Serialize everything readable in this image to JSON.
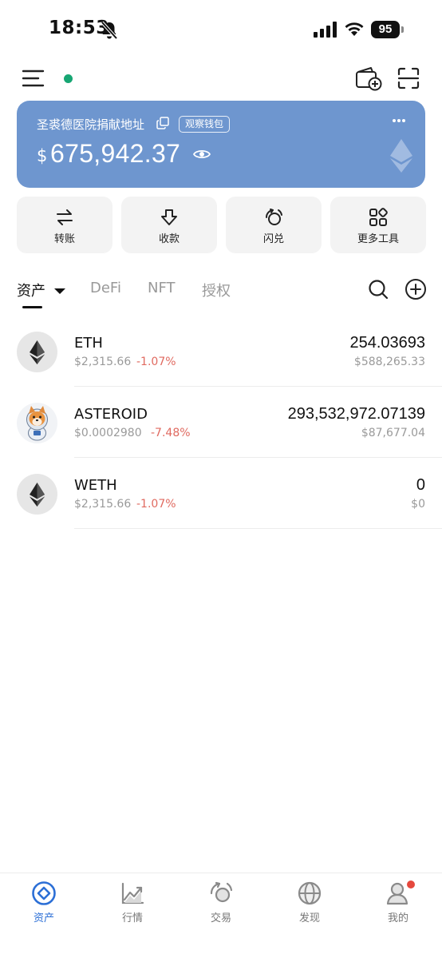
{
  "status_bar": {
    "time": "18:53",
    "battery": "95",
    "icons": [
      "bell-muted-icon",
      "signal-icon",
      "wifi-icon",
      "battery-icon"
    ]
  },
  "top_bar": {
    "icons": [
      "menu-icon",
      "wallet-add-icon",
      "scan-icon"
    ],
    "online_dot_color": "#17a673"
  },
  "wallet_card": {
    "name": "圣裘德医院捐献地址",
    "badge": "观察钱包",
    "currency_symbol": "$",
    "balance": "675,942.37",
    "background_color": "#6e96cf"
  },
  "actions": [
    {
      "label": "转账",
      "icon": "transfer-icon"
    },
    {
      "label": "收款",
      "icon": "receive-icon"
    },
    {
      "label": "闪兑",
      "icon": "swap-icon"
    },
    {
      "label": "更多工具",
      "icon": "tools-grid-icon"
    }
  ],
  "tabs": [
    {
      "label": "资产",
      "active": true
    },
    {
      "label": "DeFi",
      "active": false
    },
    {
      "label": "NFT",
      "active": false
    },
    {
      "label": "授权",
      "active": false
    }
  ],
  "tokens": [
    {
      "symbol": "ETH",
      "price": "$2,315.66",
      "change": "-1.07%",
      "amount": "254.03693",
      "value": "$588,265.33",
      "logo": "eth-logo-icon"
    },
    {
      "symbol": "ASTEROID",
      "price": "$0.0002980",
      "change": "-7.48%",
      "amount": "293,532,972.07139",
      "value": "$87,677.04",
      "logo": "shiba-astronaut-icon"
    },
    {
      "symbol": "WETH",
      "price": "$2,315.66",
      "change": "-1.07%",
      "amount": "0",
      "value": "$0",
      "logo": "eth-logo-icon"
    }
  ],
  "bottom_nav": [
    {
      "label": "资产",
      "icon": "assets-icon",
      "active": true
    },
    {
      "label": "行情",
      "icon": "market-icon",
      "active": false
    },
    {
      "label": "交易",
      "icon": "trade-icon",
      "active": false
    },
    {
      "label": "发现",
      "icon": "discover-globe-icon",
      "active": false
    },
    {
      "label": "我的",
      "icon": "profile-icon",
      "active": false,
      "badge": true
    }
  ],
  "colors": {
    "accent": "#2c6fd6",
    "negative": "#e06a60",
    "card": "#6e96cf"
  }
}
